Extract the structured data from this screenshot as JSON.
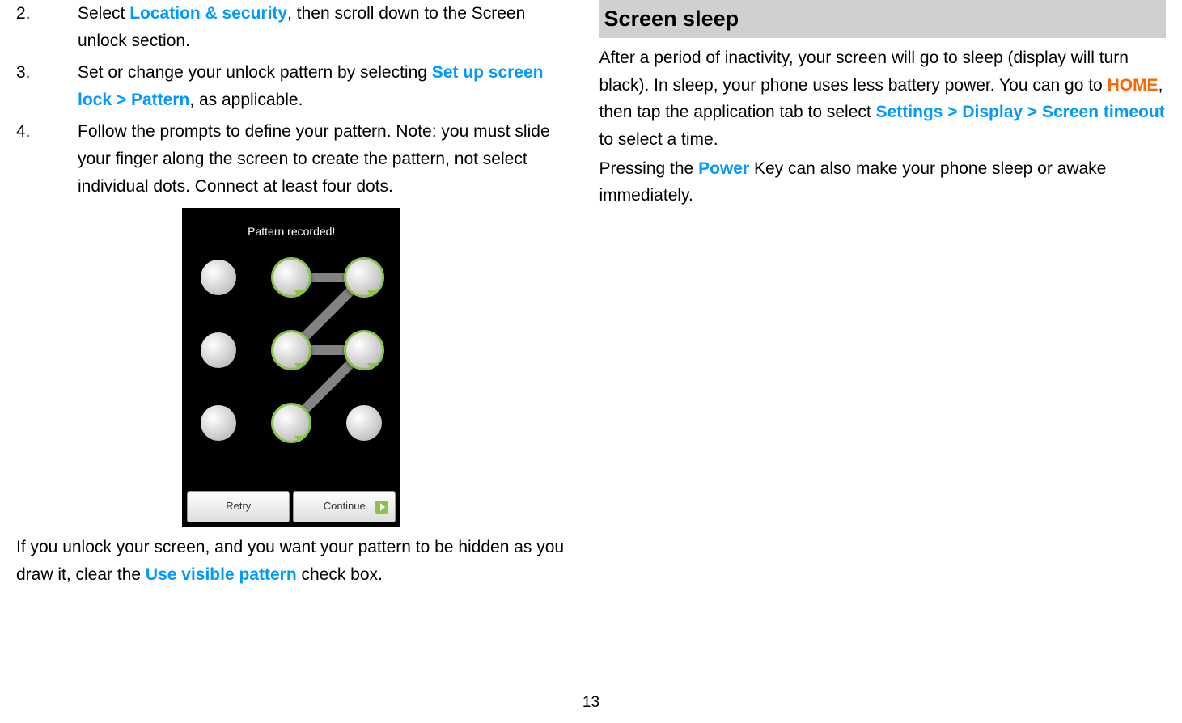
{
  "left": {
    "items": [
      {
        "number": "2.",
        "parts": [
          {
            "text": "Select ",
            "class": ""
          },
          {
            "text": "Location & security",
            "class": "link"
          },
          {
            "text": ", then scroll down to the Screen unlock section.",
            "class": ""
          }
        ]
      },
      {
        "number": "3.",
        "parts": [
          {
            "text": "Set or change your unlock pattern by selecting ",
            "class": ""
          },
          {
            "text": "Set up screen lock > Pattern",
            "class": "link"
          },
          {
            "text": ", as applicable.",
            "class": ""
          }
        ]
      },
      {
        "number": "4.",
        "parts": [
          {
            "text": "Follow the prompts to define your pattern. Note: you must slide your finger along the screen to create the pattern, not select individual dots. Connect at least four dots.",
            "class": ""
          }
        ]
      }
    ],
    "screenshot": {
      "status": "Pattern recorded!",
      "retry": "Retry",
      "continue": "Continue"
    },
    "bottom": {
      "parts": [
        {
          "text": "If you unlock your screen, and you want your pattern to be hidden as you draw it, clear the ",
          "class": ""
        },
        {
          "text": "Use visible pattern",
          "class": "link"
        },
        {
          "text": " check box.",
          "class": ""
        }
      ]
    }
  },
  "right": {
    "header": "Screen sleep",
    "para1": {
      "parts": [
        {
          "text": "After a period of inactivity, your screen will go to sleep (display will turn black). In sleep, your phone uses less battery power. You can go to ",
          "class": ""
        },
        {
          "text": "HOME",
          "class": "orange"
        },
        {
          "text": ", then tap the application tab to select ",
          "class": ""
        },
        {
          "text": "Settings > Display > Screen timeout",
          "class": "link"
        },
        {
          "text": " to select a time.",
          "class": ""
        }
      ]
    },
    "para2": {
      "parts": [
        {
          "text": "Pressing the ",
          "class": ""
        },
        {
          "text": "Power",
          "class": "link"
        },
        {
          "text": " Key can also make your phone sleep or awake immediately.",
          "class": ""
        }
      ]
    }
  },
  "pageNumber": "13"
}
